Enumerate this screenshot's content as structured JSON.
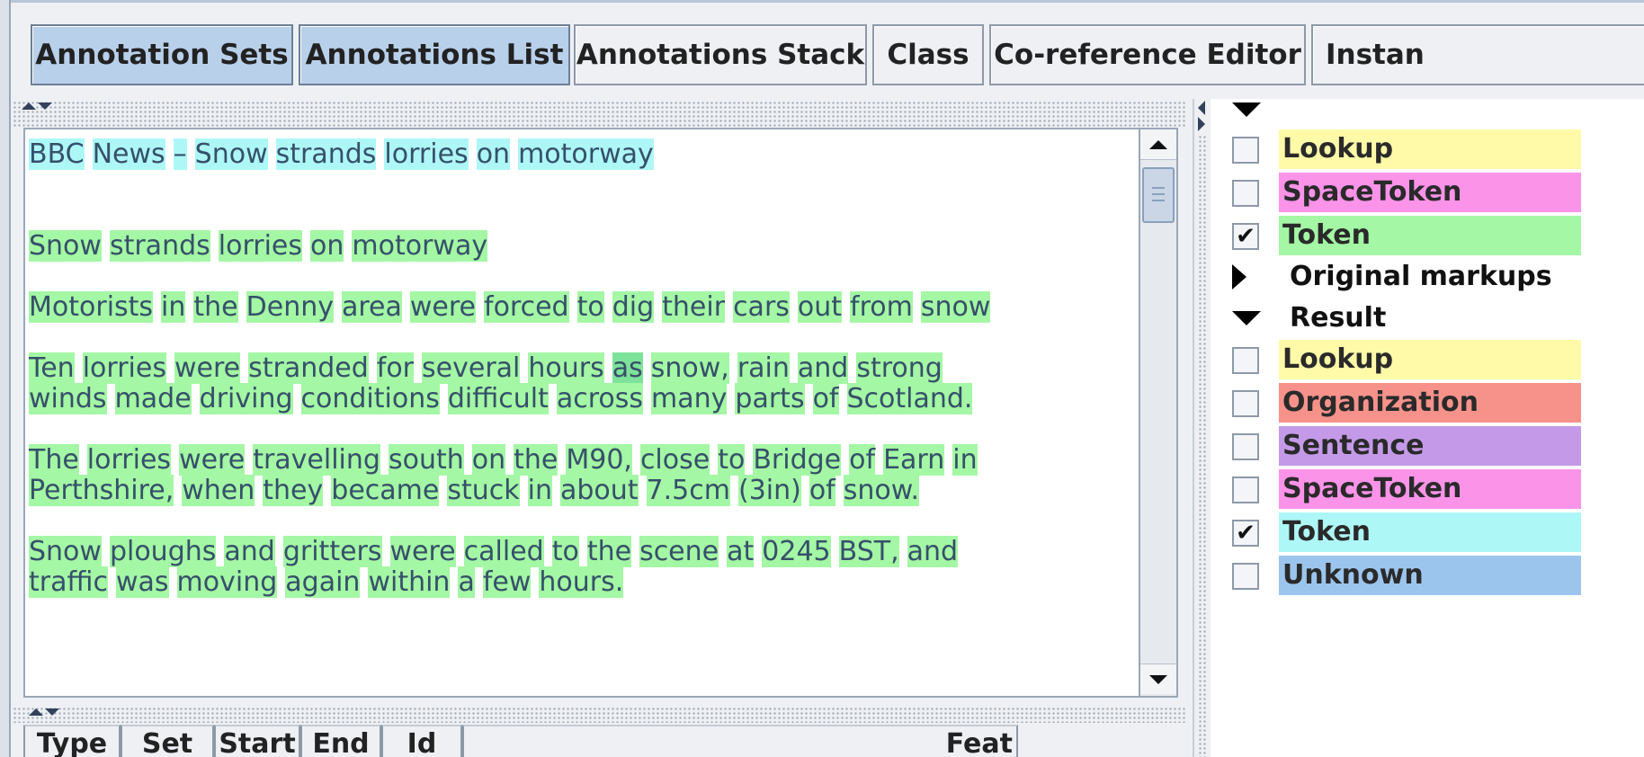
{
  "toolbar": {
    "tabs": [
      {
        "label": "Annotation Sets",
        "active": true
      },
      {
        "label": "Annotations List",
        "active": true
      },
      {
        "label": "Annotations Stack",
        "active": false
      },
      {
        "label": "Class",
        "active": false
      },
      {
        "label": "Co-reference Editor",
        "active": false
      },
      {
        "label": "Instan",
        "active": false
      }
    ]
  },
  "document": {
    "lines": [
      [
        "BBC",
        "News",
        "–",
        "Snow",
        "strands",
        "lorries",
        "on",
        "motorway"
      ],
      [
        "Snow",
        "strands",
        "lorries",
        "on",
        "motorway"
      ],
      [
        "Motorists",
        "in",
        "the",
        "Denny",
        "area",
        "were",
        "forced",
        "to",
        "dig",
        "their",
        "cars",
        "out",
        "from",
        "snow"
      ],
      [
        "Ten",
        "lorries",
        "were",
        "stranded",
        "for",
        "several",
        "hours",
        "as",
        "snow,",
        "rain",
        "and",
        "strong"
      ],
      [
        "winds",
        "made",
        "driving",
        "conditions",
        "difficult",
        "across",
        "many",
        "parts",
        "of",
        "Scotland."
      ],
      [
        "The",
        "lorries",
        "were",
        "travelling",
        "south",
        "on",
        "the",
        "M90,",
        "close",
        "to",
        "Bridge",
        "of",
        "Earn",
        "in"
      ],
      [
        "Perthshire,",
        "when",
        "they",
        "became",
        "stuck",
        "in",
        "about",
        "7.5cm",
        "(3in)",
        "of",
        "snow."
      ],
      [
        "Snow",
        "ploughs",
        "and",
        "gritters",
        "were",
        "called",
        "to",
        "the",
        "scene",
        "at",
        "0245",
        "BST,",
        "and"
      ],
      [
        "traffic",
        "was",
        "moving",
        "again",
        "within",
        "a",
        "few",
        "hours."
      ]
    ],
    "selected_token": "as",
    "colors": {
      "token": "#a4f7a4",
      "title_token": "#aef7f7",
      "selected": "#7ee39a",
      "text": "#36506a"
    }
  },
  "table": {
    "columns": [
      "Type",
      "Set",
      "Start",
      "End",
      "Id",
      "Feat"
    ]
  },
  "annotation_sets": {
    "default_set": {
      "expanded": true,
      "types": [
        {
          "label": "Lookup",
          "checked": false,
          "color": "#fffaa8"
        },
        {
          "label": "SpaceToken",
          "checked": false,
          "color": "#fb93e9"
        },
        {
          "label": "Token",
          "checked": true,
          "color": "#a4f7a4"
        }
      ]
    },
    "original_markups": {
      "label": "Original markups",
      "expanded": false
    },
    "result": {
      "label": "Result",
      "expanded": true,
      "types": [
        {
          "label": "Lookup",
          "checked": false,
          "color": "#fffaa8"
        },
        {
          "label": "Organization",
          "checked": false,
          "color": "#f7928b"
        },
        {
          "label": "Sentence",
          "checked": false,
          "color": "#c49ae8"
        },
        {
          "label": "SpaceToken",
          "checked": false,
          "color": "#fb93e9"
        },
        {
          "label": "Token",
          "checked": true,
          "color": "#aef7f7"
        },
        {
          "label": "Unknown",
          "checked": false,
          "color": "#9cc5ee"
        }
      ]
    },
    "check_mark": "✔"
  }
}
